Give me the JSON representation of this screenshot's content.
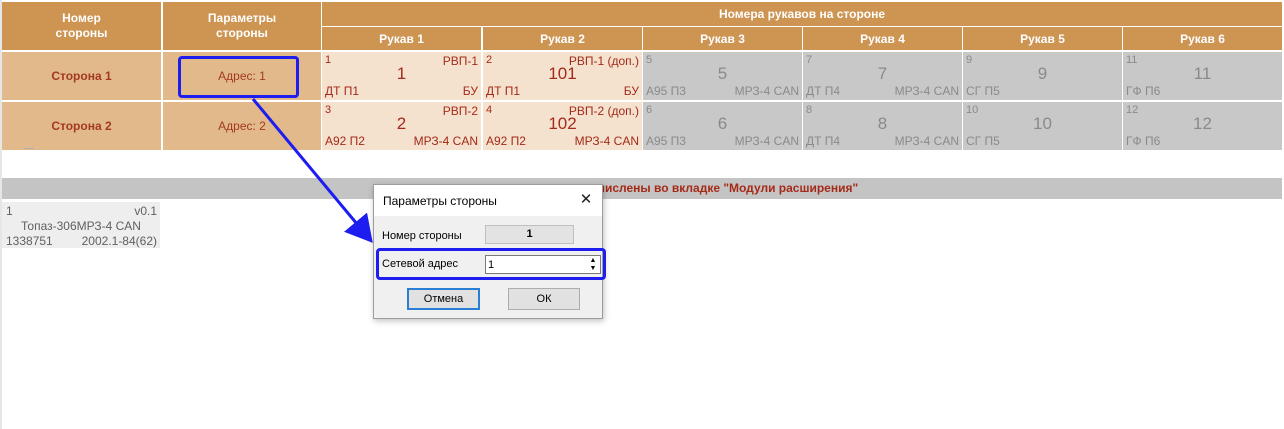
{
  "header": {
    "side_number": "Номер\nстороны",
    "side_params": "Параметры\nстороны",
    "hose_numbers_group": "Номера рукавов на стороне",
    "hose_columns": [
      "Рукав 1",
      "Рукав 2",
      "Рукав 3",
      "Рукав 4",
      "Рукав 5",
      "Рукав 6"
    ]
  },
  "sides": [
    {
      "name": "Сторона 1",
      "address": "Адрес: 1",
      "hoses": [
        {
          "n": "1",
          "type": "РВП-1",
          "big": "1",
          "fuel": "ДТ П1",
          "mod": "БУ",
          "active": true
        },
        {
          "n": "2",
          "type": "РВП-1 (доп.)",
          "big": "101",
          "fuel": "ДТ П1",
          "mod": "БУ",
          "active": true
        },
        {
          "n": "5",
          "type": "",
          "big": "5",
          "fuel": "А95 П3",
          "mod": "МРЗ-4 CAN",
          "active": false
        },
        {
          "n": "7",
          "type": "",
          "big": "7",
          "fuel": "ДТ П4",
          "mod": "МРЗ-4 CAN",
          "active": false
        },
        {
          "n": "9",
          "type": "",
          "big": "9",
          "fuel": "СГ П5",
          "mod": "",
          "active": false
        },
        {
          "n": "11",
          "type": "",
          "big": "11",
          "fuel": "ГФ П6",
          "mod": "",
          "active": false
        }
      ]
    },
    {
      "name": "Сторона 2",
      "address": "Адрес: 2",
      "hoses": [
        {
          "n": "3",
          "type": "РВП-2",
          "big": "2",
          "fuel": "А92 П2",
          "mod": "МРЗ-4 CAN",
          "active": true
        },
        {
          "n": "4",
          "type": "РВП-2 (доп.)",
          "big": "102",
          "fuel": "А92 П2",
          "mod": "МРЗ-4 CAN",
          "active": true
        },
        {
          "n": "6",
          "type": "",
          "big": "6",
          "fuel": "А95 П3",
          "mod": "МРЗ-4 CAN",
          "active": false
        },
        {
          "n": "8",
          "type": "",
          "big": "8",
          "fuel": "ДТ П4",
          "mod": "МРЗ-4 CAN",
          "active": false
        },
        {
          "n": "10",
          "type": "",
          "big": "10",
          "fuel": "СГ П5",
          "mod": "",
          "active": false
        },
        {
          "n": "12",
          "type": "",
          "big": "12",
          "fuel": "ГФ П6",
          "mod": "",
          "active": false
        }
      ]
    }
  ],
  "modules_bar": {
    "text": "числены во вкладке \"Модули расширения\""
  },
  "module": {
    "index": "1",
    "version": "v0.1",
    "name": "Топаз-306МРЗ-4 CAN",
    "serial": "1338751",
    "date": "2002.1-84(62)"
  },
  "dialog": {
    "title": "Параметры стороны",
    "side_number_label": "Номер стороны",
    "side_number_value": "1",
    "network_address_label": "Сетевой адрес",
    "network_address_value": "1",
    "cancel_label": "Отмена",
    "ok_label": "ОК",
    "close_icon": "close-icon"
  },
  "colors": {
    "header": "#cd9452",
    "side_cell": "#e2b98a",
    "active_hose": "#f4e2cf",
    "inactive_hose": "#c8c8c8",
    "accent_text": "#a52a18",
    "annotation": "#1d1df0"
  }
}
